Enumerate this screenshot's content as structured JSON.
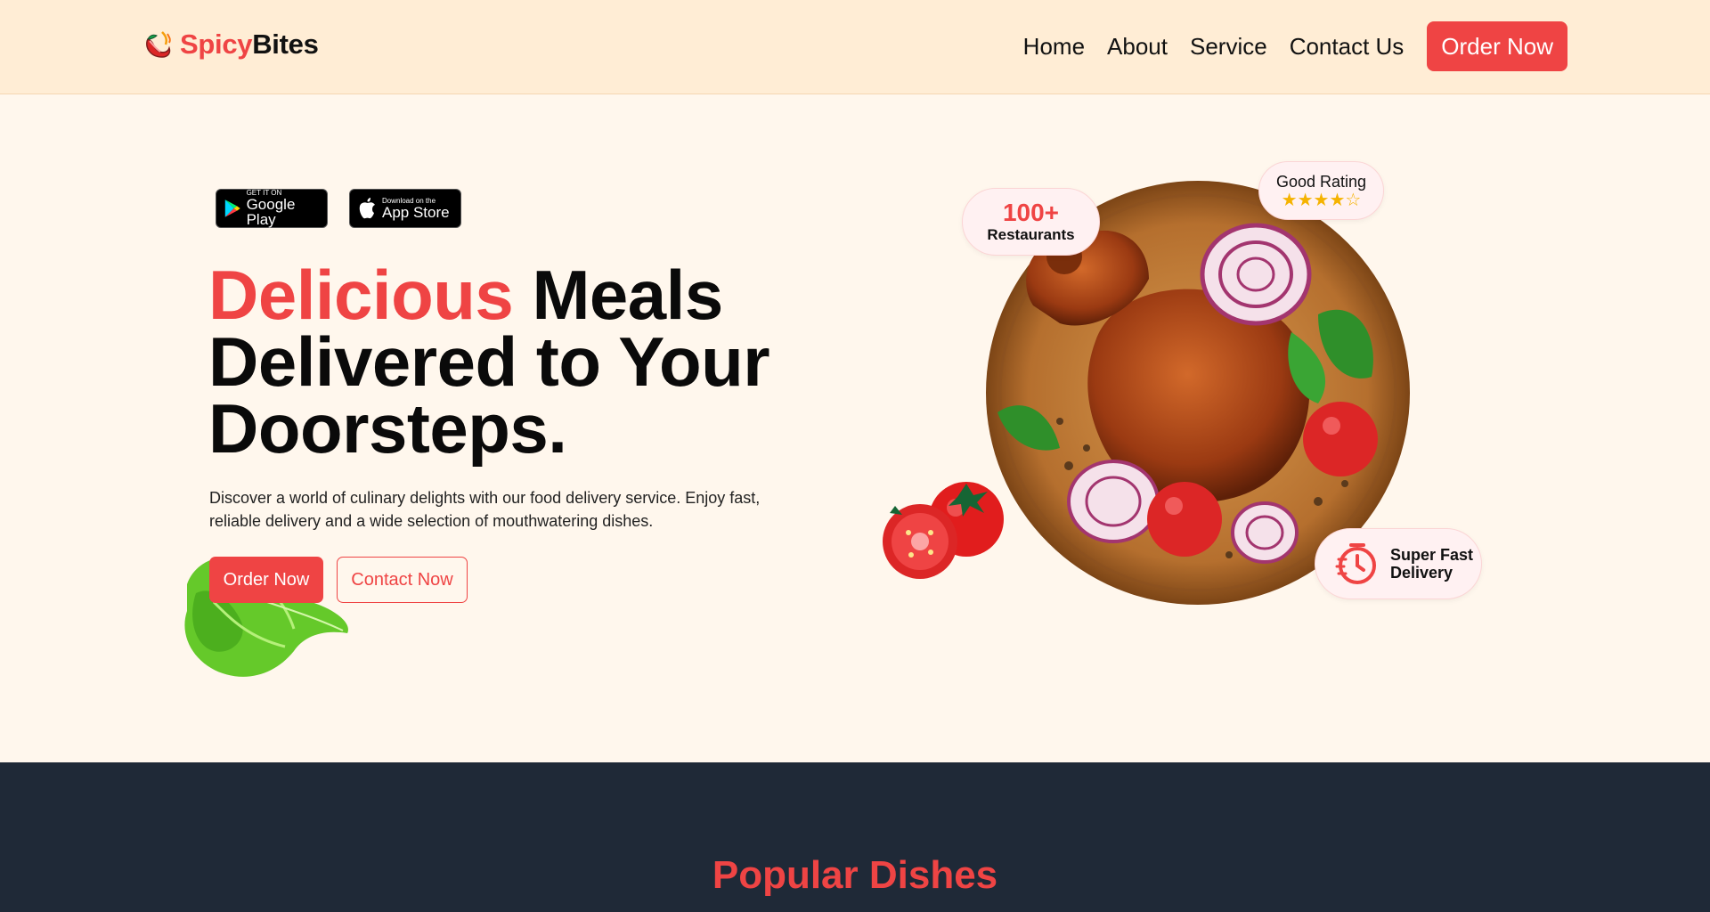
{
  "brand": {
    "part1": "Spicy",
    "part2": "Bites",
    "accent": "#ef4444"
  },
  "nav": {
    "links": [
      "Home",
      "About",
      "Service",
      "Contact Us"
    ],
    "cta": "Order Now"
  },
  "store_badges": {
    "google": {
      "small": "GET IT ON",
      "big": "Google Play"
    },
    "apple": {
      "small": "Download on the",
      "big": "App Store"
    }
  },
  "hero": {
    "headline_red": "Delicious",
    "headline_rest_1": " Meals",
    "headline_line2": "Delivered to Your",
    "headline_line3": "Doorsteps.",
    "description": "Discover a world of culinary delights with our food delivery service. Enjoy fast, reliable delivery and a wide selection of mouthwatering dishes.",
    "primary_button": "Order Now",
    "secondary_button": "Contact Now"
  },
  "stats": {
    "restaurants_count": "100+",
    "restaurants_label": "Restaurants",
    "rating_label": "Good Rating",
    "rating_stars": "★★★★☆",
    "rating_value": 4,
    "delivery_line1": "Super Fast",
    "delivery_line2": "Delivery"
  },
  "popular": {
    "title": "Popular Dishes"
  },
  "colors": {
    "header_bg": "#ffedd5",
    "hero_bg": "#fff7ed",
    "primary": "#ef4444",
    "dark_section": "#1f2937",
    "star": "#f5b301"
  },
  "icons": [
    "chili-logo-icon",
    "google-play-icon",
    "apple-icon",
    "delivery-timer-icon"
  ]
}
